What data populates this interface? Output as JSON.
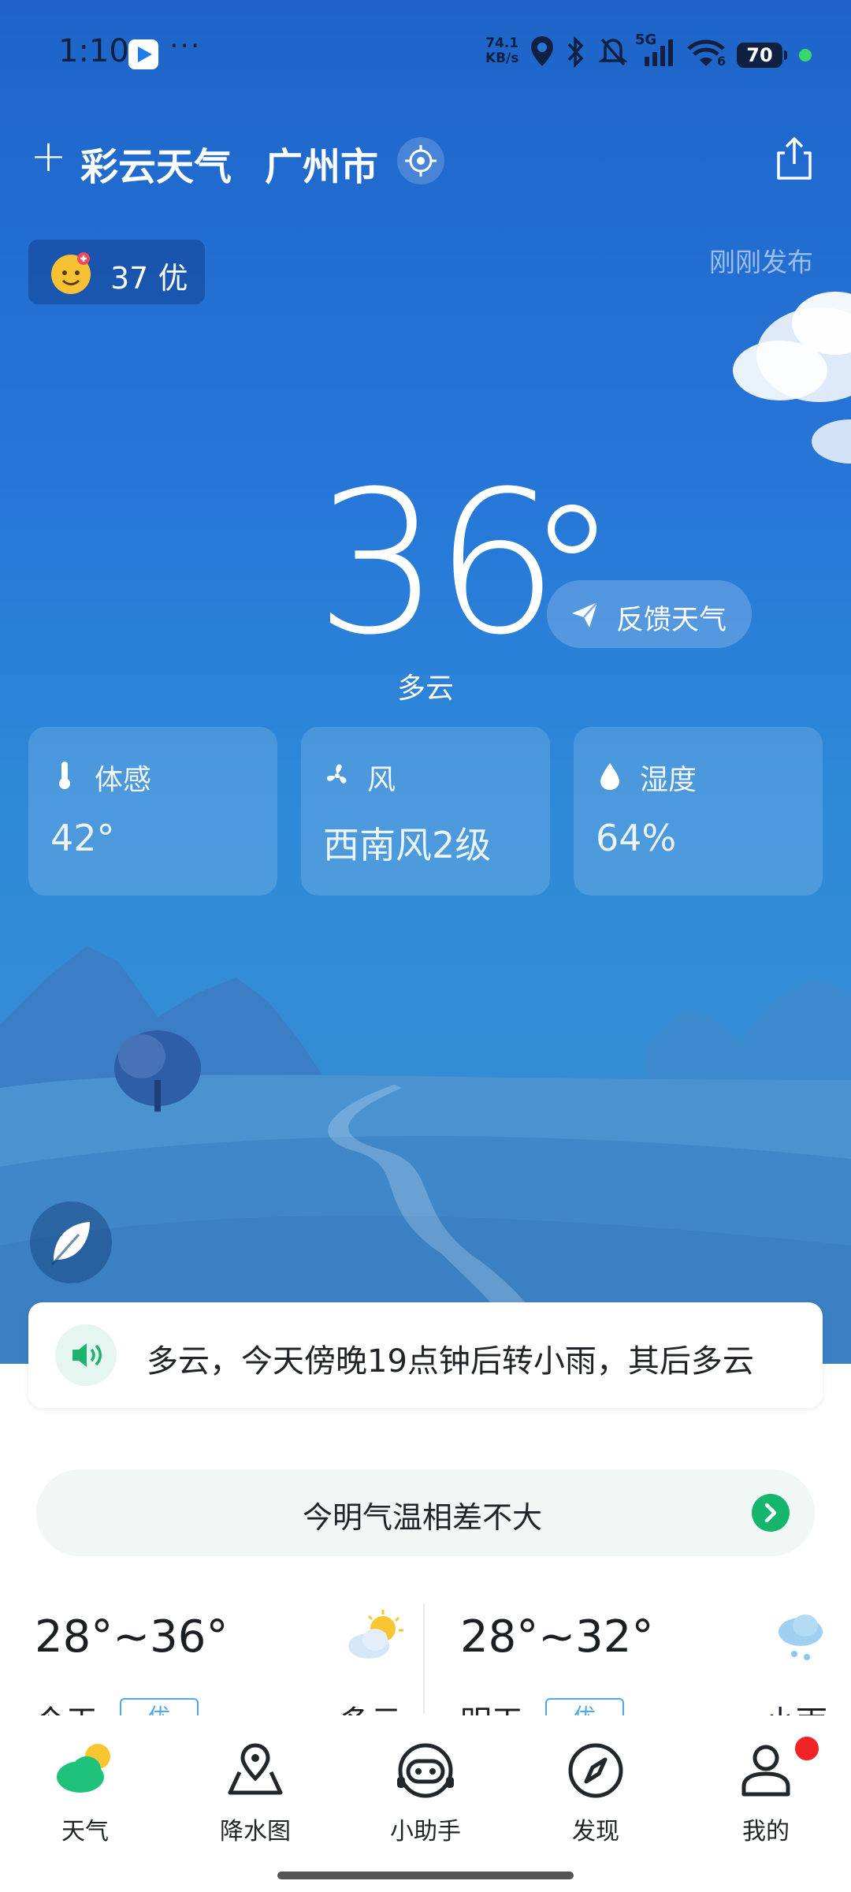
{
  "status_bar": {
    "time": "1:10",
    "net_speed_value": "74.1",
    "net_speed_unit": "KB/s",
    "signal_label": "5G",
    "wifi_label": "6",
    "battery": "70"
  },
  "header": {
    "app_name": "彩云天气",
    "city": "广州市"
  },
  "aqi": {
    "value": "37",
    "level": "优"
  },
  "publish_status": "刚刚发布",
  "current": {
    "temperature": "36",
    "condition": "多云",
    "feedback_label": "反馈天气"
  },
  "cards": [
    {
      "label": "体感",
      "value": "42°",
      "icon": "thermometer-icon"
    },
    {
      "label": "风",
      "value": "西南风2级",
      "icon": "fan-icon"
    },
    {
      "label": "湿度",
      "value": "64%",
      "icon": "water-drop-icon"
    }
  ],
  "broadcast": "多云，今天傍晚19点钟后转小雨，其后多云",
  "compare": "今明气温相差不大",
  "forecast": [
    {
      "range": "28°~36°",
      "day": "今天",
      "quality": "优",
      "condition": "多云",
      "icon": "partly-cloudy-icon"
    },
    {
      "range": "28°~32°",
      "day": "明天",
      "quality": "优",
      "condition": "小雨",
      "icon": "light-rain-icon"
    }
  ],
  "tabs": [
    {
      "label": "天气",
      "icon": "weather-icon"
    },
    {
      "label": "降水图",
      "icon": "map-pin-icon"
    },
    {
      "label": "小助手",
      "icon": "robot-icon"
    },
    {
      "label": "发现",
      "icon": "compass-icon"
    },
    {
      "label": "我的",
      "icon": "user-icon"
    }
  ],
  "colors": {
    "sky_top": "#1e64c8",
    "sky_bottom": "#3a8fd0",
    "accent_green": "#16b56d",
    "quality_blue": "#4fa8e8",
    "badge_red": "#f02424"
  }
}
